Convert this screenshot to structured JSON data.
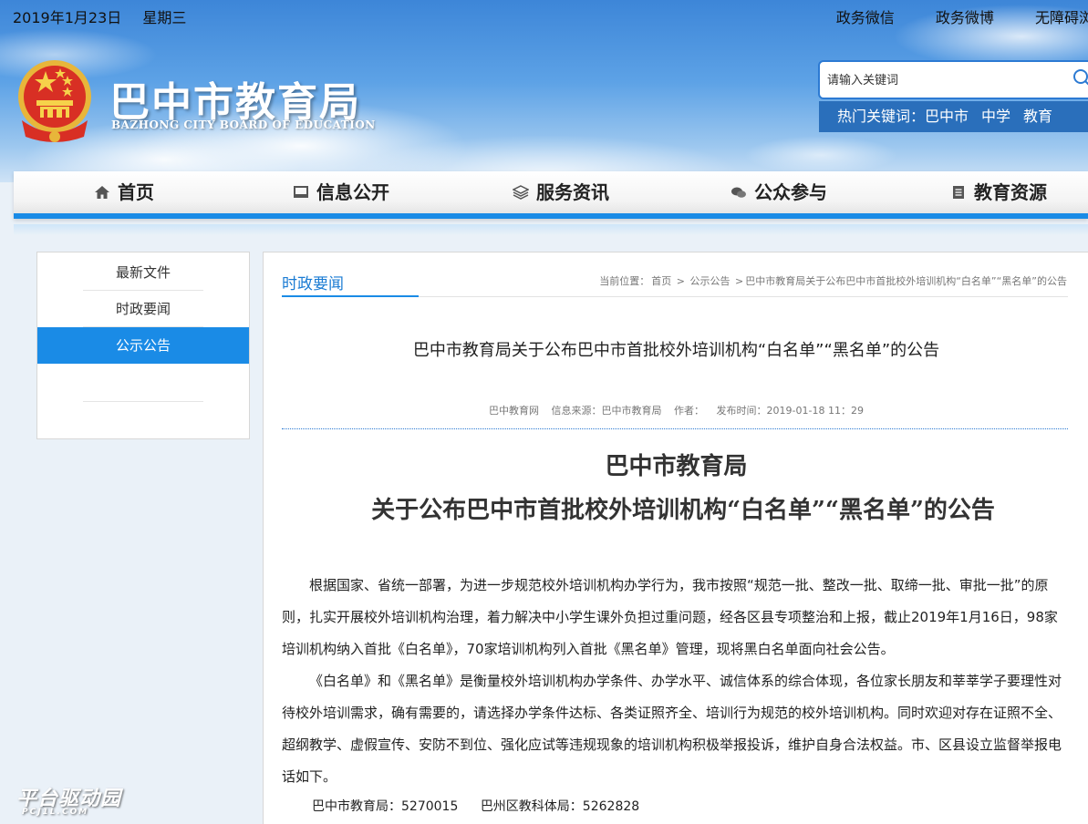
{
  "topbar": {
    "date": "2019年1月23日",
    "weekday": "星期三",
    "links": [
      "政务微信",
      "政务微博",
      "无障碍浏"
    ]
  },
  "header": {
    "site_title": "巴中市教育局",
    "site_subtitle": "BAZHONG CITY BOARD OF EDUCATION",
    "search_placeholder": "请输入关键词",
    "hot_label": "热门关键词：",
    "hot_keywords": [
      "巴中市",
      "中学",
      "教育"
    ]
  },
  "nav": {
    "items": [
      {
        "label": "首页",
        "icon": "home-icon"
      },
      {
        "label": "信息公开",
        "icon": "monitor-icon"
      },
      {
        "label": "服务资讯",
        "icon": "layers-icon"
      },
      {
        "label": "公众参与",
        "icon": "chat-icon"
      },
      {
        "label": "教育资源",
        "icon": "document-icon"
      }
    ]
  },
  "sidebar": {
    "items": [
      {
        "label": "最新文件",
        "active": false
      },
      {
        "label": "时政要闻",
        "active": false
      },
      {
        "label": "公示公告",
        "active": true
      }
    ]
  },
  "main": {
    "tab_label": "时政要闻",
    "breadcrumb": {
      "prefix": "当前位置：",
      "items": [
        "首页",
        "公示公告",
        "巴中市教育局关于公布巴中市首批校外培训机构“白名单”“黑名单”的公告"
      ],
      "separator": ">"
    },
    "article_title": "巴中市教育局关于公布巴中市首批校外培训机构“白名单”“黑名单”的公告",
    "meta": {
      "site": "巴中教育网",
      "source": "信息来源：巴中市教育局",
      "author": "作者：",
      "published": "发布时间：2019-01-18 11：29"
    },
    "doc_heading_1": "巴中市教育局",
    "doc_heading_2": "关于公布巴中市首批校外培训机构“白名单”“黑名单”的公告",
    "paragraphs": [
      "根据国家、省统一部署，为进一步规范校外培训机构办学行为，我市按照“规范一批、整改一批、取缔一批、审批一批”的原则，扎实开展校外培训机构治理，着力解决中小学生课外负担过重问题，经各区县专项整治和上报，截止2019年1月16日，98家培训机构纳入首批《白名单》，70家培训机构列入首批《黑名单》管理，现将黑白名单面向社会公告。",
      "《白名单》和《黑名单》是衡量校外培训机构办学条件、办学水平、诚信体系的综合体现，各位家长朋友和莘莘学子要理性对待校外培训需求，确有需要的，请选择办学条件达标、各类证照齐全、培训行为规范的校外培训机构。同时欢迎对存在证照不全、超纲教学、虚假宣传、安防不到位、强化应试等违规现象的培训机构积极举报投诉，维护自身合法权益。市、区县设立监督举报电话如下。"
    ],
    "contacts": [
      "巴中市教育局：5270015",
      "巴州区教科体局：5262828"
    ]
  },
  "watermark": {
    "text": "平台驱动园",
    "sub": "PCJ1L.COM"
  },
  "colors": {
    "accent": "#1a8be6",
    "hot_bar": "#2a6fbb",
    "tab_text": "#1a7bd3"
  }
}
